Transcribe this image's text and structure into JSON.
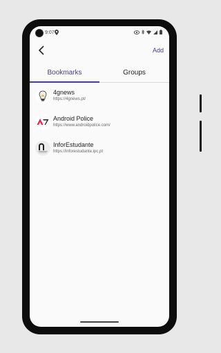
{
  "status": {
    "time": "9:07"
  },
  "appbar": {
    "add_label": "Add"
  },
  "tabs": [
    {
      "label": "Bookmarks"
    },
    {
      "label": "Groups"
    }
  ],
  "bookmarks": [
    {
      "title": "4gnews",
      "url": "https://4gnews.pt/",
      "icon": "lightbulb-logo"
    },
    {
      "title": "Android Police",
      "url": "https://www.androidpolice.com/",
      "icon": "android-police-logo"
    },
    {
      "title": "InforEstudante",
      "url": "https://inforestudante.ipc.pt",
      "icon": "inforestudante-logo"
    }
  ],
  "colors": {
    "accent": "#4a3a8c"
  }
}
